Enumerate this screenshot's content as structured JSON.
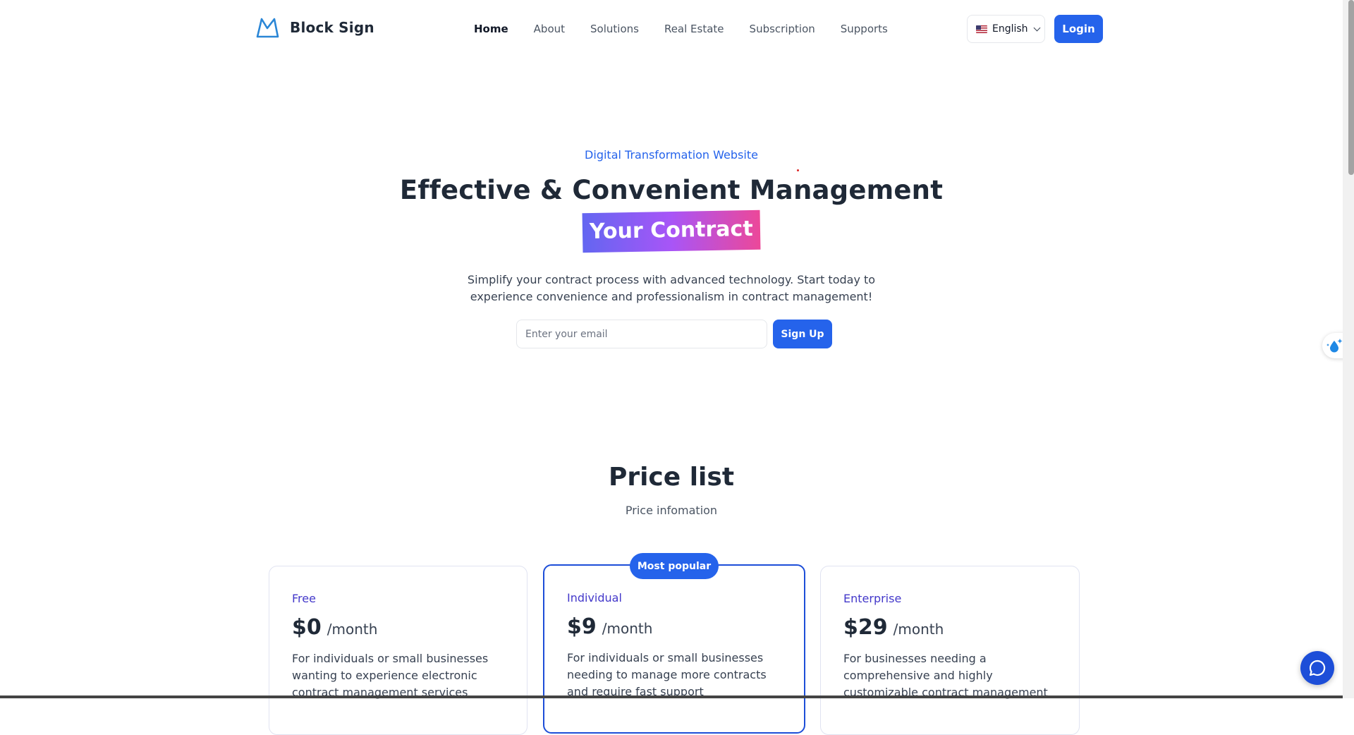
{
  "brand": {
    "name": "Block Sign"
  },
  "nav": {
    "items": [
      {
        "label": "Home",
        "active": true
      },
      {
        "label": "About"
      },
      {
        "label": "Solutions"
      },
      {
        "label": "Real Estate"
      },
      {
        "label": "Subscription"
      },
      {
        "label": "Supports"
      }
    ]
  },
  "header": {
    "language": "English",
    "language_flag": "us-flag-icon",
    "login_label": "Login"
  },
  "hero": {
    "eyebrow": "Digital Transformation Website",
    "headline": "Effective & Convenient Management",
    "highlight": "Your Contract",
    "description": "Simplify your contract process with advanced technology. Start today to experience convenience and professionalism in contract management!",
    "email_placeholder": "Enter your email",
    "email_value": "",
    "signup_label": "Sign Up"
  },
  "pricing": {
    "title": "Price list",
    "subtitle": "Price infomation",
    "badge": "Most popular",
    "plans": [
      {
        "name": "Free",
        "price": "$0",
        "period": "/month",
        "description": "For individuals or small businesses wanting to experience electronic contract management services"
      },
      {
        "name": "Individual",
        "price": "$9",
        "period": "/month",
        "description": "For individuals or small businesses needing to manage more contracts and require fast support"
      },
      {
        "name": "Enterprise",
        "price": "$29",
        "period": "/month",
        "description": "For businesses needing a comprehensive and highly customizable contract management"
      }
    ]
  },
  "colors": {
    "primary": "#2563eb",
    "accent_text": "#4338ca",
    "gradient": [
      "#6366f1",
      "#a855f7",
      "#ec4899"
    ]
  }
}
